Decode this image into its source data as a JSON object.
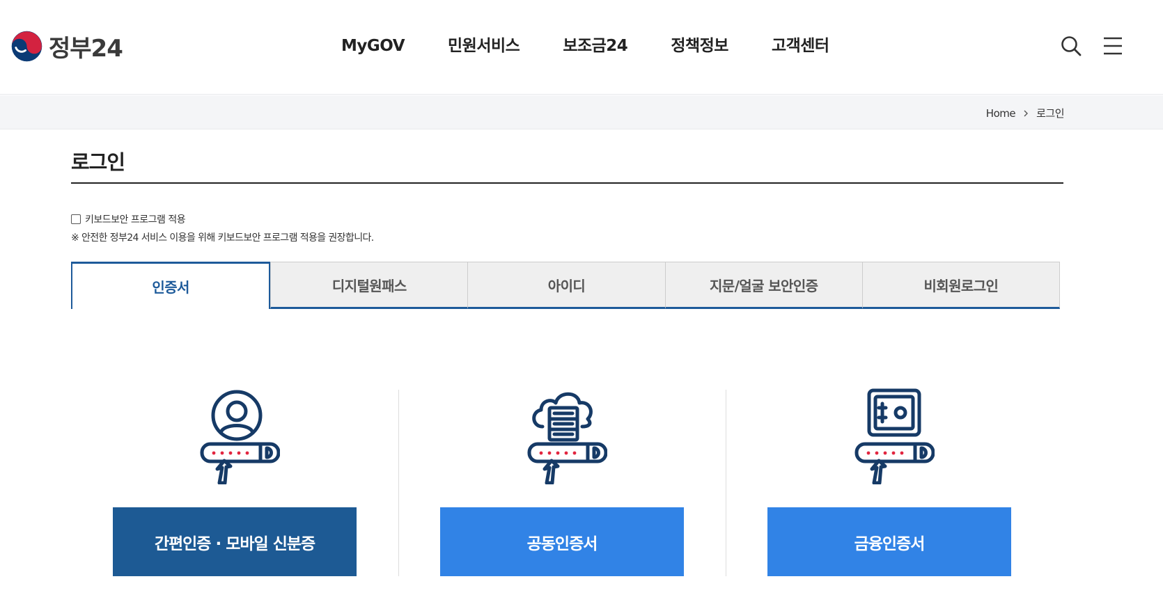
{
  "header": {
    "logo_text": "정부24",
    "nav": [
      "MyGOV",
      "민원서비스",
      "보조금24",
      "정책정보",
      "고객센터"
    ],
    "search_icon": "search-icon",
    "menu_icon": "menu-icon"
  },
  "breadcrumb": {
    "home": "Home",
    "current": "로그인"
  },
  "page": {
    "title": "로그인",
    "keyboard_security_label": "키보드보안 프로그램 적용",
    "keyboard_security_checked": false,
    "keyboard_security_note": "※ 안전한 정부24 서비스 이용을 위해 키보드보안 프로그램 적용을 권장합니다."
  },
  "tabs": [
    {
      "label": "인증서",
      "active": true
    },
    {
      "label": "디지털원패스",
      "active": false
    },
    {
      "label": "아이디",
      "active": false
    },
    {
      "label": "지문/얼굴 보안인증",
      "active": false
    },
    {
      "label": "비회원로그인",
      "active": false
    }
  ],
  "cards": [
    {
      "icon": "user-password-icon",
      "button": "간편인증 · 모바일 신분증"
    },
    {
      "icon": "cloud-server-password-icon",
      "button": "공동인증서"
    },
    {
      "icon": "safe-password-icon",
      "button": "금융인증서"
    }
  ],
  "colors": {
    "primary_dark": "#1d5a94",
    "primary_blue": "#3183e6",
    "tab_active": "#1d5a9a",
    "icon_navy": "#163a66",
    "password_dots": "#e2253f"
  }
}
